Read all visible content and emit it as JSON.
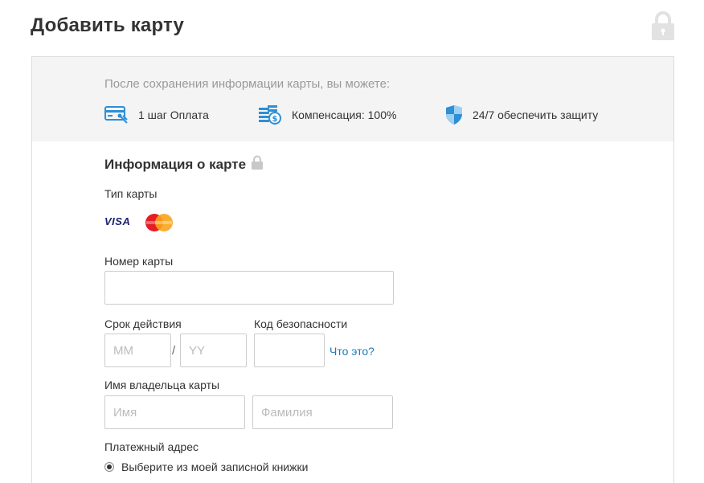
{
  "page": {
    "title": "Добавить карту",
    "header_icon": "lock-icon"
  },
  "benefits": {
    "intro": "После сохранения информации карты, вы можете:",
    "items": [
      {
        "icon": "card-payment-icon",
        "label": "1 шаг Оплата"
      },
      {
        "icon": "coins-compensation-icon",
        "label": "Компенсация: 100%"
      },
      {
        "icon": "shield-icon",
        "label": "24/7 обеспечить защиту"
      }
    ]
  },
  "card_info": {
    "title": "Информация о карте",
    "title_icon": "lock-icon",
    "card_type_label": "Тип карты",
    "card_types": [
      {
        "name": "VISA",
        "icon": "visa-logo"
      },
      {
        "name": "MasterCard",
        "icon": "mastercard-logo"
      }
    ],
    "card_number": {
      "label": "Номер карты",
      "value": "",
      "placeholder": ""
    },
    "expiry": {
      "label": "Срок действия",
      "month_placeholder": "MM",
      "separator": "/",
      "year_placeholder": "YY"
    },
    "security_code": {
      "label": "Код безопасности",
      "placeholder": "",
      "help_link": "Что это?"
    },
    "holder": {
      "label": "Имя владельца карты",
      "first_name_placeholder": "Имя",
      "last_name_placeholder": "Фамилия"
    },
    "billing": {
      "label": "Платежный адрес",
      "option": "Выберите из моей записной книжки",
      "option_selected": true
    }
  },
  "colors": {
    "link": "#1e7bb8",
    "benefit_icon": "#2d8fd5",
    "header_band": "#f4f4f4",
    "mastercard_red": "#e31e24",
    "mastercard_yellow": "#f9a51a"
  }
}
